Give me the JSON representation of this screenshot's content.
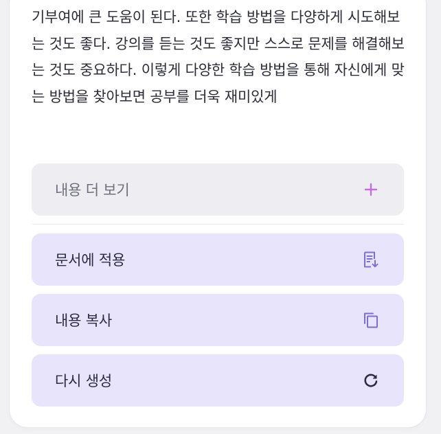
{
  "content": {
    "paragraph": "기부여에 큰 도움이 된다. 또한 학습 방법을 다양하게 시도해보는 것도 좋다. 강의를 듣는 것도 좋지만 스스로 문제를 해결해보는 것도 중요하다. 이렇게 다양한 학습 방법을 통해 자신에게 맞는 방법을 찾아보면 공부를 더욱 재미있게"
  },
  "actions": {
    "more": {
      "label": "내용 더 보기",
      "icon": "plus-icon"
    },
    "apply": {
      "label": "문서에 적용",
      "icon": "insert-document-icon"
    },
    "copy": {
      "label": "내용 복사",
      "icon": "copy-icon"
    },
    "regenerate": {
      "label": "다시 생성",
      "icon": "refresh-icon"
    }
  },
  "colors": {
    "accent": "#8b5cf6",
    "icon_purple": "#7b6fd6",
    "button_purple_bg": "#e8e4fb",
    "button_gray_bg": "#eeeef2"
  }
}
